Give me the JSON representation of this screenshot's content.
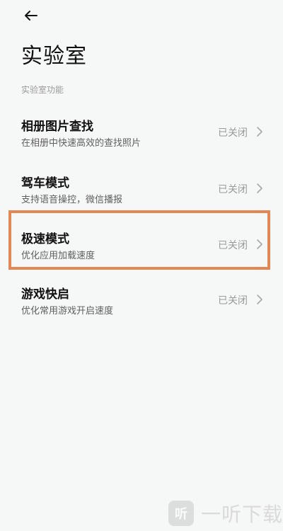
{
  "header": {
    "back_icon": "back-arrow-icon",
    "title": "实验室"
  },
  "section": {
    "label": "实验室功能"
  },
  "items": [
    {
      "title": "相册图片查找",
      "subtitle": "在相册中快速高效的查找照片",
      "status": "已关闭",
      "icon": "chevron-right-icon"
    },
    {
      "title": "驾车模式",
      "subtitle": "支持语音操控，微信播报",
      "status": "已关闭",
      "icon": "chevron-right-icon"
    },
    {
      "title": "极速模式",
      "subtitle": "优化应用加载速度",
      "status": "已关闭",
      "icon": "chevron-right-icon"
    },
    {
      "title": "游戏快启",
      "subtitle": "优化常用游戏开启速度",
      "status": "已关闭",
      "icon": "chevron-right-icon"
    }
  ],
  "highlight": {
    "color": "#e58755",
    "target": "极速模式"
  },
  "watermark": {
    "logo_text": "听",
    "text": "一听下载"
  }
}
